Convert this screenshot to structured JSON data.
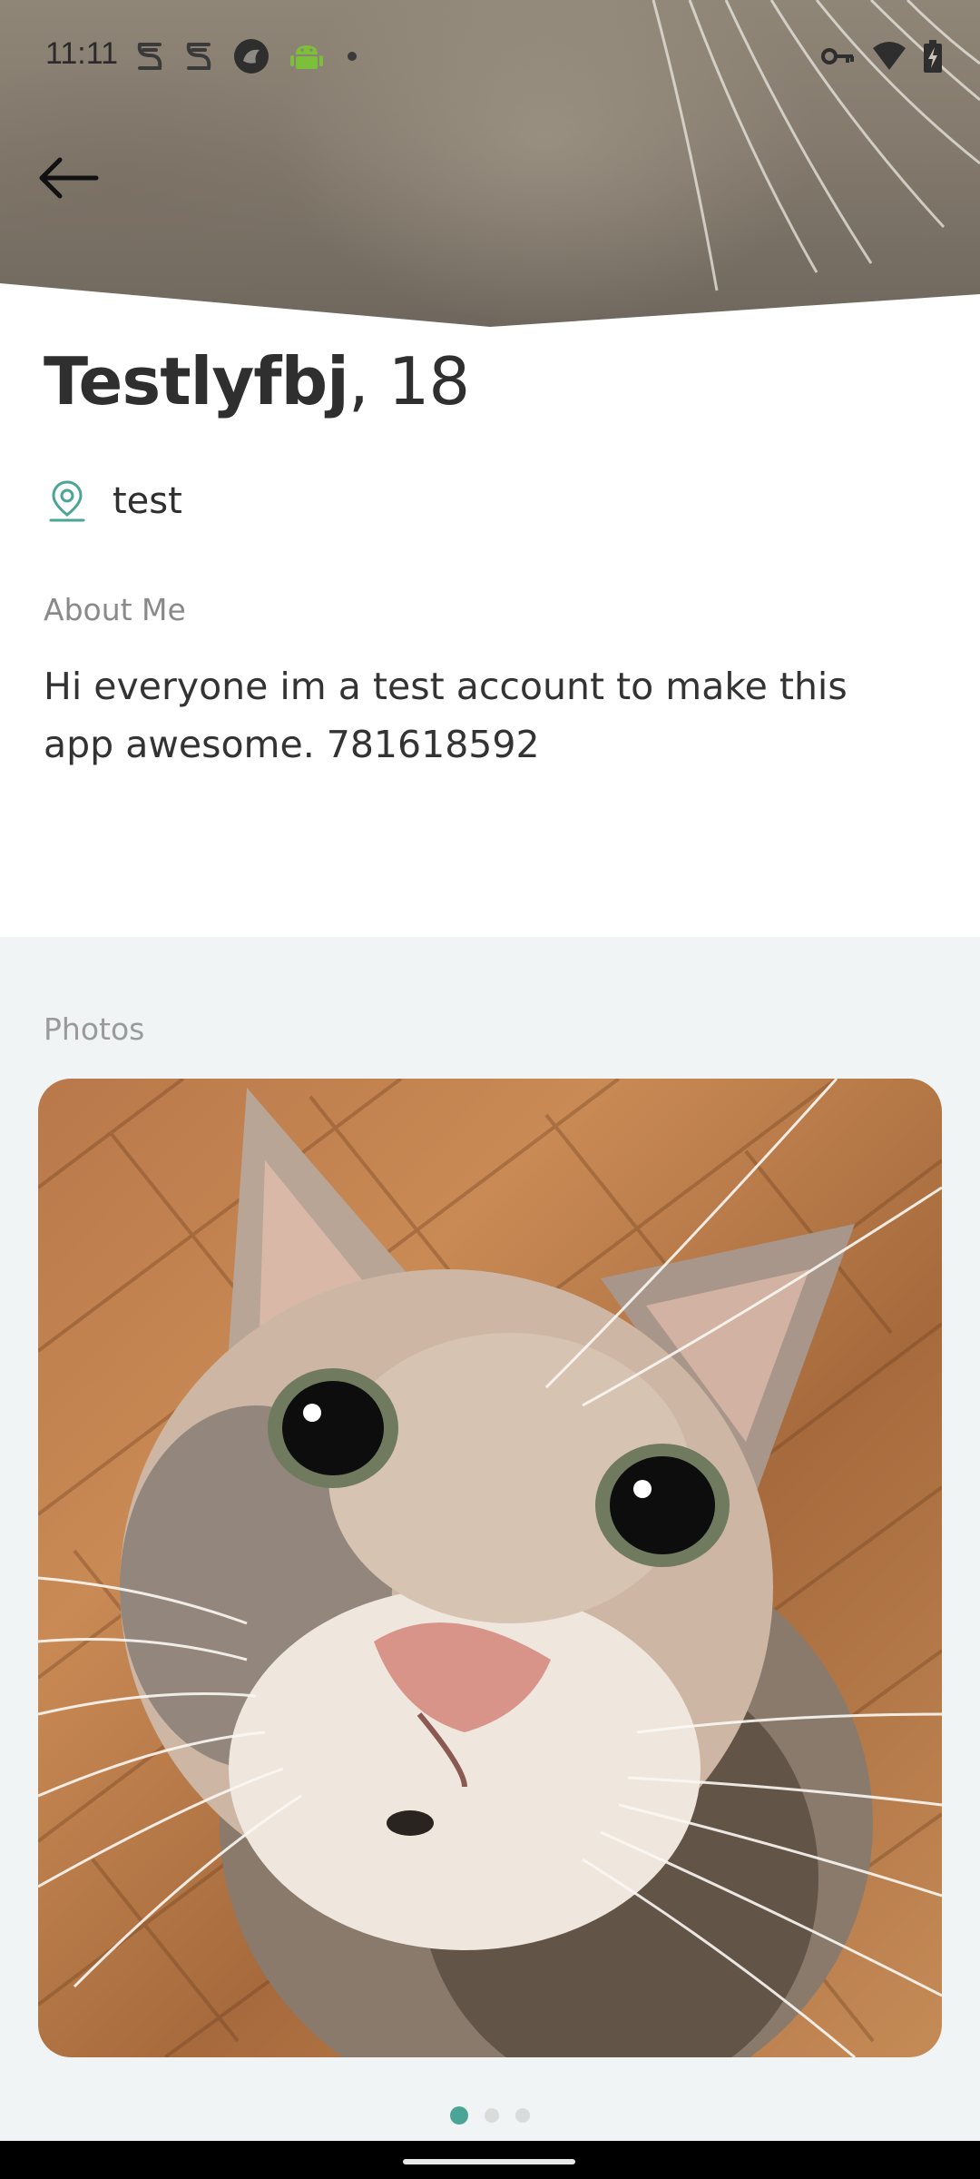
{
  "status_bar": {
    "time": "11:11",
    "left_icons": [
      "s-app-icon",
      "s-app-icon",
      "browser-icon",
      "android-icon",
      "dot-icon"
    ],
    "right_icons": [
      "vpn-key-icon",
      "wifi-icon",
      "battery-charging-icon"
    ]
  },
  "header": {
    "back_icon": "arrow-left-icon"
  },
  "profile": {
    "name": "Testlyfbj",
    "age_text": ", 18",
    "location": "test",
    "location_icon": "location-pin-icon",
    "about_label": "About Me",
    "about_text": "Hi everyone im a test account to make this app awesome. 781618592"
  },
  "photos": {
    "label": "Photos",
    "page_count": 3,
    "active_page": 1
  },
  "colors": {
    "accent": "#4aa597",
    "text_primary": "#2f2f2f",
    "text_secondary": "#8a8a8a",
    "section_bg": "#f1f4f4"
  }
}
